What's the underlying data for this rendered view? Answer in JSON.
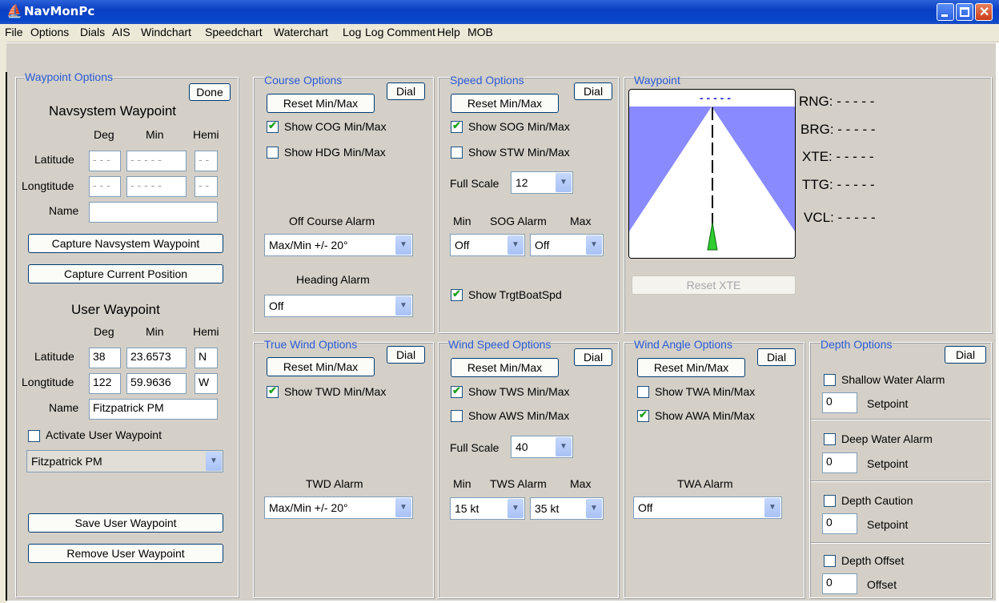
{
  "window": {
    "title": "NavMonPc"
  },
  "menu": [
    "File",
    "Options",
    "Dials",
    "AIS",
    "Windchart",
    "Speedchart",
    "Waterchart",
    "Log",
    "Log Comment",
    "Help",
    "MOB"
  ],
  "waypoint_options": {
    "title": "Waypoint Options",
    "done": "Done",
    "navsystem_heading": "Navsystem Waypoint",
    "col_deg": "Deg",
    "col_min": "Min",
    "col_hemi": "Hemi",
    "latitude_label": "Latitude",
    "longitude_label": "Longtitude",
    "name_label": "Name",
    "nav_lat_deg": "- - -",
    "nav_lat_min": "- - - - -",
    "nav_lat_hemi": "- -",
    "nav_lon_deg": "- - -",
    "nav_lon_min": "- - - - -",
    "nav_lon_hemi": "- -",
    "nav_name": "",
    "capture_nav": "Capture Navsystem Waypoint",
    "capture_pos": "Capture Current Position",
    "user_heading": "User Waypoint",
    "user_lat_deg": "38",
    "user_lat_min": "23.6573",
    "user_lat_hemi": "N",
    "user_lon_deg": "122",
    "user_lon_min": "59.9636",
    "user_lon_hemi": "W",
    "user_name": "Fitzpatrick PM",
    "activate_label": "Activate User Waypoint",
    "activate_checked": false,
    "waypoint_select": "Fitzpatrick PM",
    "save": "Save User Waypoint",
    "remove": "Remove User Waypoint"
  },
  "course_options": {
    "title": "Course Options",
    "dial": "Dial",
    "reset": "Reset Min/Max",
    "show_cog": "Show COG Min/Max",
    "show_cog_checked": true,
    "show_hdg": "Show HDG Min/Max",
    "show_hdg_checked": false,
    "off_course_label": "Off Course Alarm",
    "off_course_value": "Max/Min +/- 20°",
    "heading_label": "Heading Alarm",
    "heading_value": "Off"
  },
  "speed_options": {
    "title": "Speed Options",
    "dial": "Dial",
    "reset": "Reset Min/Max",
    "show_sog": "Show SOG Min/Max",
    "show_sog_checked": true,
    "show_stw": "Show STW Min/Max",
    "show_stw_checked": false,
    "full_scale_label": "Full Scale",
    "full_scale_value": "12",
    "min_label": "Min",
    "alarm_label": "SOG Alarm",
    "max_label": "Max",
    "min_value": "Off",
    "max_value": "Off",
    "show_trgt": "Show TrgtBoatSpd",
    "show_trgt_checked": true
  },
  "waypoint_panel": {
    "title": "Waypoint",
    "xte_dashes": "- - - - -",
    "rng": "RNG: - - - - -",
    "brg": "BRG: - - - - -",
    "xte": "XTE: - - - - -",
    "ttg": "TTG: - - - - -",
    "vcl": "VCL: - - - - -",
    "reset_xte": "Reset XTE"
  },
  "true_wind_options": {
    "title": "True Wind Options",
    "dial": "Dial",
    "reset": "Reset Min/Max",
    "show_twd": "Show TWD Min/Max",
    "show_twd_checked": true,
    "alarm_label": "TWD Alarm",
    "alarm_value": "Max/Min +/- 20°"
  },
  "wind_speed_options": {
    "title": "Wind Speed Options",
    "dial": "Dial",
    "reset": "Reset Min/Max",
    "show_tws": "Show TWS Min/Max",
    "show_tws_checked": true,
    "show_aws": "Show AWS Min/Max",
    "show_aws_checked": false,
    "full_scale_label": "Full Scale",
    "full_scale_value": "40",
    "min_label": "Min",
    "alarm_label": "TWS Alarm",
    "max_label": "Max",
    "min_value": "15 kt",
    "max_value": "35 kt"
  },
  "wind_angle_options": {
    "title": "Wind Angle Options",
    "dial": "Dial",
    "reset": "Reset Min/Max",
    "show_twa": "Show TWA Min/Max",
    "show_twa_checked": false,
    "show_awa": "Show AWA Min/Max",
    "show_awa_checked": true,
    "alarm_label": "TWA Alarm",
    "alarm_value": "Off"
  },
  "depth_options": {
    "title": "Depth Options",
    "dial": "Dial",
    "shallow": "Shallow Water Alarm",
    "shallow_value": "0",
    "shallow_unit": "Setpoint",
    "deep": "Deep Water Alarm",
    "deep_value": "0",
    "deep_unit": "Setpoint",
    "caution": "Depth Caution",
    "caution_value": "0",
    "caution_unit": "Setpoint",
    "offset": "Depth Offset",
    "offset_value": "0",
    "offset_unit": "Offset"
  },
  "colors": {
    "title_bar": "#0a3fc3",
    "group_title": "#2a5bd7",
    "client_bg": "#d4d0c8",
    "chart_lane": "#8a8aff",
    "boat": "#2fcc2f"
  }
}
